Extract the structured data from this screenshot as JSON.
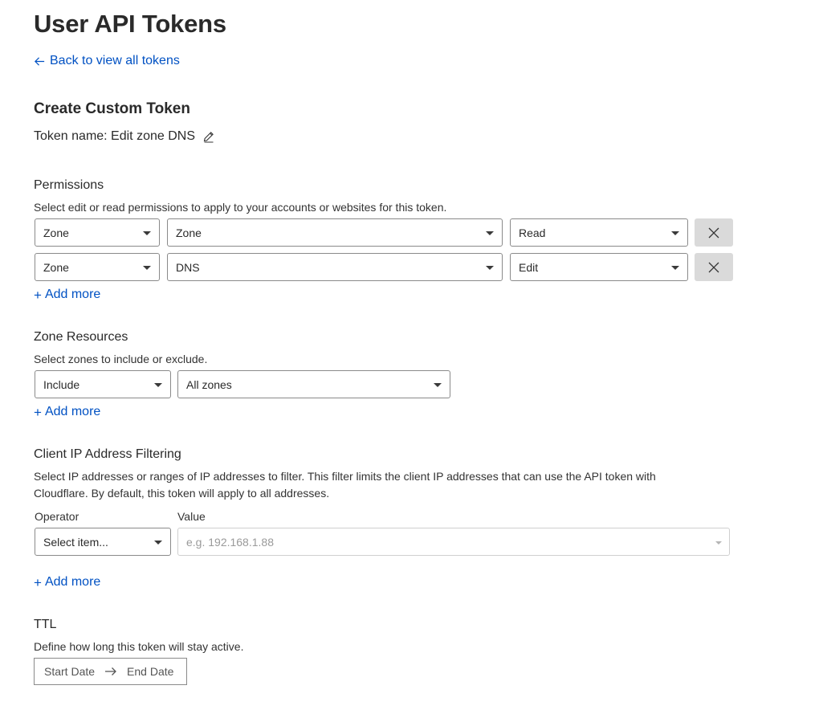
{
  "page": {
    "title": "User API Tokens",
    "back_link": "Back to view all tokens",
    "section_title": "Create Custom Token",
    "token_name_label": "Token name: Edit zone DNS"
  },
  "permissions": {
    "heading": "Permissions",
    "help": "Select edit or read permissions to apply to your accounts or websites for this token.",
    "rows": [
      {
        "scope": "Zone",
        "resource": "Zone",
        "access": "Read"
      },
      {
        "scope": "Zone",
        "resource": "DNS",
        "access": "Edit"
      }
    ],
    "add_more": "Add more"
  },
  "zone_resources": {
    "heading": "Zone Resources",
    "help": "Select zones to include or exclude.",
    "mode": "Include",
    "target": "All zones",
    "add_more": "Add more"
  },
  "ip_filtering": {
    "heading": "Client IP Address Filtering",
    "help": "Select IP addresses or ranges of IP addresses to filter. This filter limits the client IP addresses that can use the API token with Cloudflare. By default, this token will apply to all addresses.",
    "operator_label": "Operator",
    "value_label": "Value",
    "operator_value": "Select item...",
    "value_placeholder": "e.g. 192.168.1.88",
    "add_more": "Add more"
  },
  "ttl": {
    "heading": "TTL",
    "help": "Define how long this token will stay active.",
    "start_date": "Start Date",
    "end_date": "End Date"
  },
  "icons": {
    "back": "arrow-left-icon",
    "edit": "pencil-icon",
    "remove": "close-icon",
    "add": "plus-icon",
    "caret": "caret-down-icon",
    "range": "arrow-right-icon"
  },
  "colors": {
    "link": "#0051c3",
    "remove_button_bg": "#dadada",
    "border": "#8a8a8a"
  }
}
